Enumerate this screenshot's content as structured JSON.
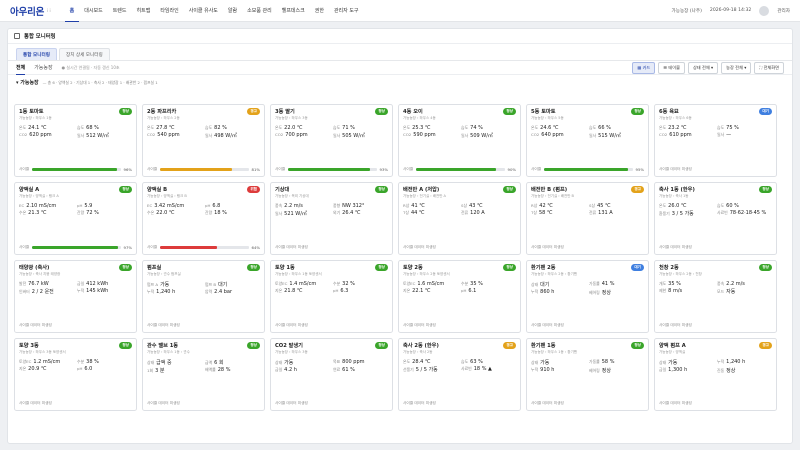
{
  "app": {
    "logo": "아우리온",
    "logo_sub": "i i"
  },
  "nav": [
    "홈",
    "대시보드",
    "트렌드",
    "히트맵",
    "타임라인",
    "사이클 유사도",
    "알람",
    "소모품 관리",
    "헬프데스크",
    "권한",
    "관리자 도구"
  ],
  "user": {
    "site": "가능농장 (나주)",
    "datetime": "2026-09-18 14:32",
    "name": "관리자"
  },
  "panel": {
    "title": "통합 모니터링",
    "view_tabs": [
      "통합 모니터링",
      "장치 상세 모니터링"
    ],
    "sub_tabs": [
      "전체",
      "가능농장"
    ],
    "refresh_note": "● 실시간 연결됨 · 자동 갱신 10초",
    "tools": [
      "▦ 카드",
      "☰ 테이블",
      "상태 전체 ▾",
      "농장 전체 ▾",
      "⛶ 전체화면"
    ],
    "group_name": "▾ 가능농장",
    "group_info": "— 총 6 · 양액실 2 · 기상대 1 · 축사 2 · 태양광 1 · 배관반 2 · 펌프실 1"
  },
  "colors": {
    "green": "#3aa52a",
    "orange": "#e3a21a",
    "red": "#dd3b3b",
    "blue": "#3f7fe0"
  },
  "devices": [
    {
      "name": "1동 토마토",
      "sub": "가능농장 › 하우스 1동",
      "badge": "정상",
      "badge_color": "green",
      "metrics": [
        [
          "온도",
          "24.1 ℃"
        ],
        [
          "습도",
          "68 %"
        ],
        [
          "CO2",
          "620 ppm"
        ],
        [
          "일사",
          "512 W/㎡"
        ]
      ],
      "foot_label": "사이클",
      "progress": 96,
      "bar_color": "green"
    },
    {
      "name": "2동 파프리카",
      "sub": "가능농장 › 하우스 2동",
      "badge": "경고",
      "badge_color": "orange",
      "metrics": [
        [
          "온도",
          "27.8 ℃"
        ],
        [
          "습도",
          "82 %"
        ],
        [
          "CO2",
          "540 ppm"
        ],
        [
          "일사",
          "498 W/㎡"
        ]
      ],
      "foot_label": "사이클",
      "progress": 81,
      "bar_color": "orange"
    },
    {
      "name": "3동 딸기",
      "sub": "가능농장 › 하우스 3동",
      "badge": "정상",
      "badge_color": "green",
      "metrics": [
        [
          "온도",
          "22.0 ℃"
        ],
        [
          "습도",
          "71 %"
        ],
        [
          "CO2",
          "700 ppm"
        ],
        [
          "일사",
          "505 W/㎡"
        ]
      ],
      "foot_label": "사이클",
      "progress": 93,
      "bar_color": "green"
    },
    {
      "name": "4동 오이",
      "sub": "가능농장 › 하우스 4동",
      "badge": "정상",
      "badge_color": "green",
      "metrics": [
        [
          "온도",
          "25.3 ℃"
        ],
        [
          "습도",
          "74 %"
        ],
        [
          "CO2",
          "590 ppm"
        ],
        [
          "일사",
          "509 W/㎡"
        ]
      ],
      "foot_label": "사이클",
      "progress": 90,
      "bar_color": "green"
    },
    {
      "name": "5동 토마토",
      "sub": "가능농장 › 하우스 5동",
      "badge": "정상",
      "badge_color": "green",
      "metrics": [
        [
          "온도",
          "24.6 ℃"
        ],
        [
          "습도",
          "66 %"
        ],
        [
          "CO2",
          "640 ppm"
        ],
        [
          "일사",
          "515 W/㎡"
        ]
      ],
      "foot_label": "사이클",
      "progress": 95,
      "bar_color": "green"
    },
    {
      "name": "6동 육묘",
      "sub": "가능농장 › 하우스 6동",
      "badge": "대기",
      "badge_color": "blue",
      "metrics": [
        [
          "온도",
          "23.2 ℃"
        ],
        [
          "습도",
          "75 %"
        ],
        [
          "CO2",
          "610 ppm"
        ],
        [
          "일사",
          "—"
        ]
      ],
      "foot_label": "사이클 데이터 미생성",
      "progress": null,
      "bar_color": "green"
    },
    {
      "name": "양액실 A",
      "sub": "가능농장 › 양액실 › 탱크 A",
      "badge": "정상",
      "badge_color": "green",
      "metrics": [
        [
          "EC",
          "2.10 mS/cm"
        ],
        [
          "pH",
          "5.9"
        ],
        [
          "수온",
          "21.3 ℃"
        ],
        [
          "잔량",
          "72 %"
        ]
      ],
      "foot_label": "사이클",
      "progress": 97,
      "bar_color": "green"
    },
    {
      "name": "양액실 B",
      "sub": "가능농장 › 양액실 › 탱크 B",
      "badge": "위험",
      "badge_color": "red",
      "metrics": [
        [
          "EC",
          "3.42 mS/cm"
        ],
        [
          "pH",
          "6.8"
        ],
        [
          "수온",
          "22.0 ℃"
        ],
        [
          "잔량",
          "18 %"
        ]
      ],
      "foot_label": "사이클",
      "progress": 64,
      "bar_color": "red"
    },
    {
      "name": "기상대",
      "sub": "가능농장 › 옥외 기상대",
      "badge": "정상",
      "badge_color": "green",
      "metrics": [
        [
          "풍속",
          "2.2 m/s"
        ],
        [
          "풍향",
          "NW 312°"
        ],
        [
          "일사",
          "521 W/㎡"
        ],
        [
          "외기",
          "26.4 ℃"
        ]
      ],
      "foot_label": "사이클 데이터 미생성",
      "progress": null,
      "bar_color": "green"
    },
    {
      "name": "배전반 A (저압)",
      "sub": "가능농장 › 전기실 › 배전반 A",
      "badge": "정상",
      "badge_color": "green",
      "metrics": [
        [
          "R상",
          "41 ℃"
        ],
        [
          "S상",
          "43 ℃"
        ],
        [
          "T상",
          "44 ℃"
        ],
        [
          "전류",
          "120 A"
        ]
      ],
      "foot_label": "사이클 데이터 미생성",
      "progress": null,
      "bar_color": "green"
    },
    {
      "name": "배전반 B (펌프)",
      "sub": "가능농장 › 전기실 › 배전반 B",
      "badge": "경고",
      "badge_color": "orange",
      "metrics": [
        [
          "R상",
          "42 ℃"
        ],
        [
          "S상",
          "45 ℃"
        ],
        [
          "T상",
          "58 ℃"
        ],
        [
          "전류",
          "131 A"
        ]
      ],
      "foot_label": "사이클 데이터 미생성",
      "progress": null,
      "bar_color": "green"
    },
    {
      "name": "축사 1동 (한우)",
      "sub": "가능농장 › 축사 1동",
      "badge": "정상",
      "badge_color": "green",
      "metrics": [
        [
          "온도",
          "26.0 ℃"
        ],
        [
          "습도",
          "60 %"
        ],
        [
          "환풍기",
          "3 / 5 가동"
        ],
        [
          "사료빈",
          "78·62·18·45 %"
        ]
      ],
      "foot_label": "사이클 데이터 미생성",
      "progress": null,
      "bar_color": "green"
    },
    {
      "name": "태양광 (축사)",
      "sub": "가능농장 › 축사 지붕 태양광",
      "badge": "정상",
      "badge_color": "green",
      "metrics": [
        [
          "발전",
          "76.7 kW"
        ],
        [
          "금일",
          "412 kWh"
        ],
        [
          "인버터",
          "2 / 2 운전"
        ],
        [
          "누적",
          "145 kWh"
        ]
      ],
      "foot_label": "사이클 데이터 미생성",
      "progress": null,
      "bar_color": "green"
    },
    {
      "name": "펌프실",
      "sub": "가능농장 › 관수 펌프실",
      "badge": "정상",
      "badge_color": "green",
      "metrics": [
        [
          "펌프 A",
          "가동"
        ],
        [
          "펌프 B",
          "대기"
        ],
        [
          "누적",
          "1,240 h"
        ],
        [
          "압력",
          "2.4 bar"
        ]
      ],
      "foot_label": "사이클 데이터 미생성",
      "progress": null,
      "bar_color": "green"
    },
    {
      "name": "토양 1동",
      "sub": "가능농장 › 하우스 1동 토양센서",
      "badge": "정상",
      "badge_color": "green",
      "metrics": [
        [
          "토양EC",
          "1.4 mS/cm"
        ],
        [
          "수분",
          "32 %"
        ],
        [
          "지온",
          "21.8 ℃"
        ],
        [
          "pH",
          "6.3"
        ]
      ],
      "foot_label": "사이클 데이터 미생성",
      "progress": null,
      "bar_color": "green"
    },
    {
      "name": "토양 2동",
      "sub": "가능농장 › 하우스 2동 토양센서",
      "badge": "정상",
      "badge_color": "green",
      "metrics": [
        [
          "토양EC",
          "1.6 mS/cm"
        ],
        [
          "수분",
          "35 %"
        ],
        [
          "지온",
          "22.1 ℃"
        ],
        [
          "pH",
          "6.1"
        ]
      ],
      "foot_label": "사이클 데이터 미생성",
      "progress": null,
      "bar_color": "green"
    },
    {
      "name": "환기팬 2동",
      "sub": "가능농장 › 하우스 2동 › 환기팬",
      "badge": "대기",
      "badge_color": "blue",
      "metrics": [
        [
          "상태",
          "대기"
        ],
        [
          "가동률",
          "41 %"
        ],
        [
          "누적",
          "860 h"
        ],
        [
          "베어링",
          "정상"
        ]
      ],
      "foot_label": "사이클 데이터 미생성",
      "progress": null,
      "bar_color": "green"
    },
    {
      "name": "천창 2동",
      "sub": "가능농장 › 하우스 2동 › 천창",
      "badge": "정상",
      "badge_color": "green",
      "metrics": [
        [
          "개도",
          "35 %"
        ],
        [
          "풍속",
          "2.2 m/s"
        ],
        [
          "제한",
          "8 m/s"
        ],
        [
          "모드",
          "자동"
        ]
      ],
      "foot_label": "사이클 데이터 미생성",
      "progress": null,
      "bar_color": "green"
    },
    {
      "name": "토양 3동",
      "sub": "가능농장 › 하우스 3동 토양센서",
      "badge": "정상",
      "badge_color": "green",
      "metrics": [
        [
          "토양EC",
          "1.2 mS/cm"
        ],
        [
          "수분",
          "38 %"
        ],
        [
          "지온",
          "20.9 ℃"
        ],
        [
          "pH",
          "6.0"
        ]
      ],
      "foot_label": "사이클 데이터 미생성",
      "progress": null,
      "bar_color": "green"
    },
    {
      "name": "관수 밸브 1동",
      "sub": "가능농장 › 하우스 1동 › 관수",
      "badge": "정상",
      "badge_color": "green",
      "metrics": [
        [
          "상태",
          "급액 중"
        ],
        [
          "급액",
          "6 회"
        ],
        [
          "1회",
          "3 분"
        ],
        [
          "배액률",
          "28 %"
        ]
      ],
      "foot_label": "사이클 데이터 미생성",
      "progress": null,
      "bar_color": "green"
    },
    {
      "name": "CO2 발생기",
      "sub": "가능농장 › 하우스 3동",
      "badge": "정상",
      "badge_color": "green",
      "metrics": [
        [
          "상태",
          "가동"
        ],
        [
          "목표",
          "800 ppm"
        ],
        [
          "금일",
          "4.2 h"
        ],
        [
          "연료",
          "61 %"
        ]
      ],
      "foot_label": "사이클 데이터 미생성",
      "progress": null,
      "bar_color": "green"
    },
    {
      "name": "축사 2동 (한우)",
      "sub": "가능농장 › 축사 2동",
      "badge": "경고",
      "badge_color": "orange",
      "metrics": [
        [
          "온도",
          "28.4 ℃"
        ],
        [
          "습도",
          "63 %"
        ],
        [
          "선풍기",
          "5 / 5 가동"
        ],
        [
          "사료빈",
          "18 % ▲"
        ]
      ],
      "foot_label": "사이클 데이터 미생성",
      "progress": null,
      "bar_color": "green"
    },
    {
      "name": "환기팬 1동",
      "sub": "가능농장 › 하우스 1동 › 환기팬",
      "badge": "정상",
      "badge_color": "green",
      "metrics": [
        [
          "상태",
          "가동"
        ],
        [
          "가동률",
          "58 %"
        ],
        [
          "누적",
          "910 h"
        ],
        [
          "베어링",
          "정상"
        ]
      ],
      "foot_label": "사이클 데이터 미생성",
      "progress": null,
      "bar_color": "green"
    },
    {
      "name": "양액 펌프 A",
      "sub": "가능농장 › 양액실",
      "badge": "경고",
      "badge_color": "orange",
      "metrics": [
        [
          "상태",
          "가동"
        ],
        [
          "누적",
          "1,240 h"
        ],
        [
          "금일",
          "1,300 h"
        ],
        [
          "진동",
          "정상"
        ]
      ],
      "foot_label": "사이클 데이터 미생성",
      "progress": null,
      "bar_color": "green"
    }
  ]
}
